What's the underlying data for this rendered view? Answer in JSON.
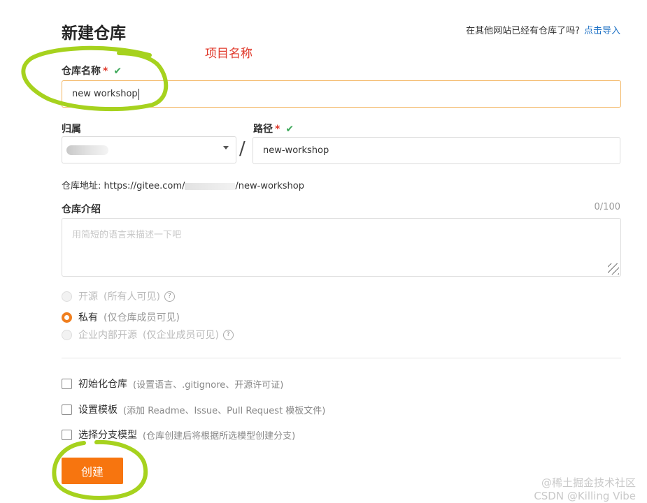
{
  "header": {
    "title": "新建仓库",
    "import_question": "在其他网站已经有仓库了吗?",
    "import_link": "点击导入"
  },
  "annotation": {
    "note": "项目名称"
  },
  "repo_name": {
    "label": "仓库名称",
    "required_mark": "*",
    "value": "new workshop"
  },
  "owner": {
    "label": "归属"
  },
  "path": {
    "label": "路径",
    "required_mark": "*",
    "value": "new-workshop",
    "separator": "/"
  },
  "repo_url": {
    "label": "仓库地址:",
    "prefix": "https://gitee.com/",
    "suffix": "/new-workshop"
  },
  "description": {
    "label": "仓库介绍",
    "counter": "0/100",
    "placeholder": "用简短的语言来描述一下吧"
  },
  "visibility": {
    "options": [
      {
        "label": "开源",
        "hint": "(所有人可见)",
        "help_icon": "question-icon",
        "selected": false,
        "disabled": true
      },
      {
        "label": "私有",
        "hint": "(仅仓库成员可见)",
        "selected": true,
        "disabled": false
      },
      {
        "label": "企业内部开源",
        "hint": "(仅企业成员可见)",
        "help_icon": "question-icon",
        "selected": false,
        "disabled": true
      }
    ]
  },
  "extras": [
    {
      "label": "初始化仓库",
      "hint": "(设置语言、.gitignore、开源许可证)",
      "checked": false
    },
    {
      "label": "设置模板",
      "hint": "(添加 Readme、Issue、Pull Request 模板文件)",
      "checked": false
    },
    {
      "label": "选择分支模型",
      "hint": "(仓库创建后将根据所选模型创建分支)",
      "checked": false
    }
  ],
  "submit": {
    "label": "创建"
  },
  "watermark": {
    "line1": "@稀土掘金技术社区",
    "line2": "CSDN @Killing Vibe"
  },
  "colors": {
    "accent": "#f7750f",
    "required": "#e0392b",
    "valid": "#3aa757",
    "highlight": "#a6d21e"
  }
}
